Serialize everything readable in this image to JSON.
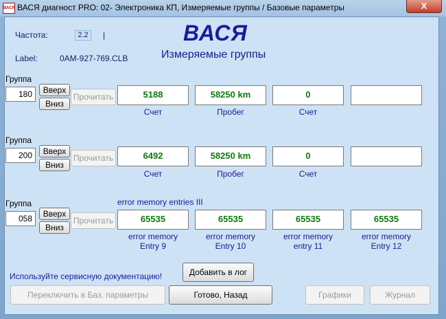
{
  "window": {
    "title": "ВАСЯ диагност PRO: 02- Электроника КП,  Измеряемые группы / Базовые параметры",
    "close_glyph": "X",
    "icon_text": "ВАСЯ"
  },
  "header": {
    "freq_label": "Частота:",
    "freq_value": "2.2",
    "freq_sep": "|",
    "label_label": "Label:",
    "label_value": "0AM-927-769.CLB",
    "brand": "ВАСЯ",
    "subtitle": "Измеряемые группы"
  },
  "buttons": {
    "up": "Вверх",
    "down": "Вниз",
    "read": "Прочитать"
  },
  "groups": [
    {
      "label": "Группа",
      "number": "180",
      "heading": "",
      "fields": [
        {
          "value": "5188",
          "caption": "Счет"
        },
        {
          "value": "58250 km",
          "caption": "Пробег"
        },
        {
          "value": "0",
          "caption": "Счет"
        },
        {
          "value": "",
          "caption": ""
        }
      ]
    },
    {
      "label": "Группа",
      "number": "200",
      "heading": "",
      "fields": [
        {
          "value": "6492",
          "caption": "Счет"
        },
        {
          "value": "58250 km",
          "caption": "Пробег"
        },
        {
          "value": "0",
          "caption": "Счет"
        },
        {
          "value": "",
          "caption": ""
        }
      ]
    },
    {
      "label": "Группа",
      "number": "058",
      "heading": "error memory entries III",
      "fields": [
        {
          "value": "65535",
          "caption": "error memory\nEntry 9"
        },
        {
          "value": "65535",
          "caption": "error memory\nEntry 10"
        },
        {
          "value": "65535",
          "caption": "error memory\nentry 11"
        },
        {
          "value": "65535",
          "caption": "error memory\nEntry 12"
        }
      ]
    }
  ],
  "footer": {
    "hint": "Используйте сервисную документацию!",
    "add_log": "Добавить в лог",
    "switch_basic": "Переключить в Баз. параметры",
    "done_back": "Готово, Назад",
    "graphs": "Графики",
    "journal": "Журнал"
  }
}
